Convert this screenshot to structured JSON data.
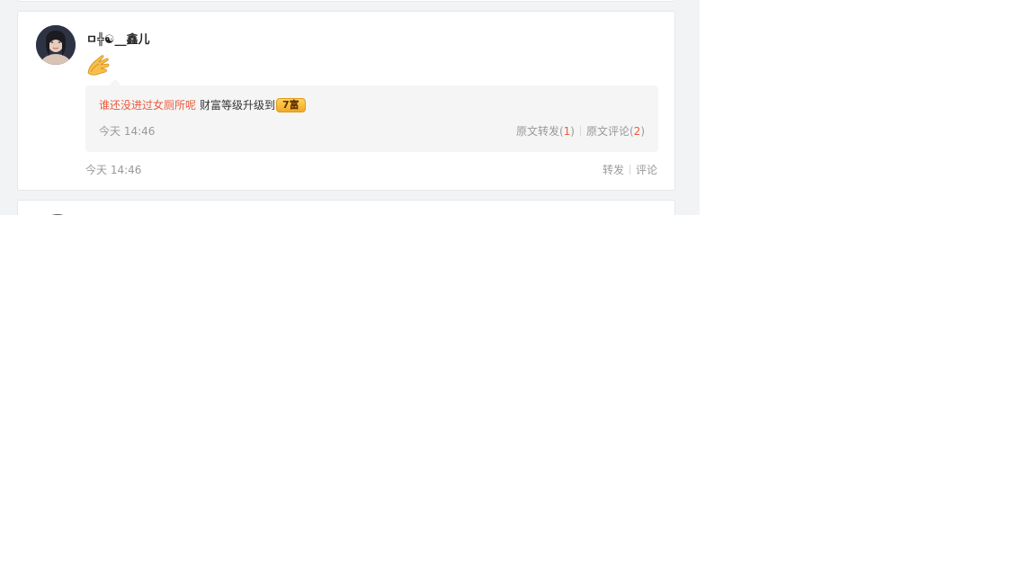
{
  "post": {
    "username": "ㅁ╬☯__鑫儿",
    "emoji": "clapping-hands-emoji",
    "time": "今天 14:46",
    "actions": {
      "repost": "转发",
      "comment": "评论"
    },
    "quote": {
      "author": "谁还没进过女厕所呢",
      "text": "财富等级升级到",
      "badge": "7富",
      "time": "今天 14:46",
      "repost_label": "原文转发(",
      "repost_count": "1",
      "comment_label": "原文评论(",
      "comment_count": "2",
      "close_paren": ")"
    }
  },
  "colors": {
    "accent": "#eb5a3c",
    "muted": "#999999",
    "background": "#f2f3f5"
  }
}
